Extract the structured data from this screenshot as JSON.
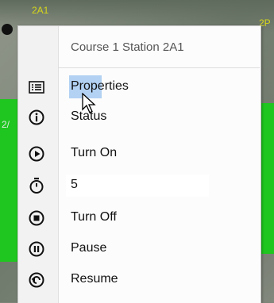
{
  "map": {
    "label_top": "2A1",
    "label_right": "2P",
    "label_left": "2/"
  },
  "menu": {
    "header": "Course 1 Station 2A1",
    "items": [
      {
        "label": "Properties",
        "icon": "properties-list-icon"
      },
      {
        "label": "Status",
        "icon": "info-circle-icon"
      },
      {
        "label": "Turn On",
        "icon": "play-circle-icon"
      },
      {
        "label": "5",
        "icon": "stopwatch-icon"
      },
      {
        "label": "Turn Off",
        "icon": "stop-circle-icon"
      },
      {
        "label": "Pause",
        "icon": "pause-circle-icon"
      },
      {
        "label": "Resume",
        "icon": "resume-circle-icon"
      }
    ]
  },
  "colors": {
    "highlight": "#99c3f0",
    "zone_green": "#1fc61f",
    "label_yellow": "#d6d61a"
  }
}
